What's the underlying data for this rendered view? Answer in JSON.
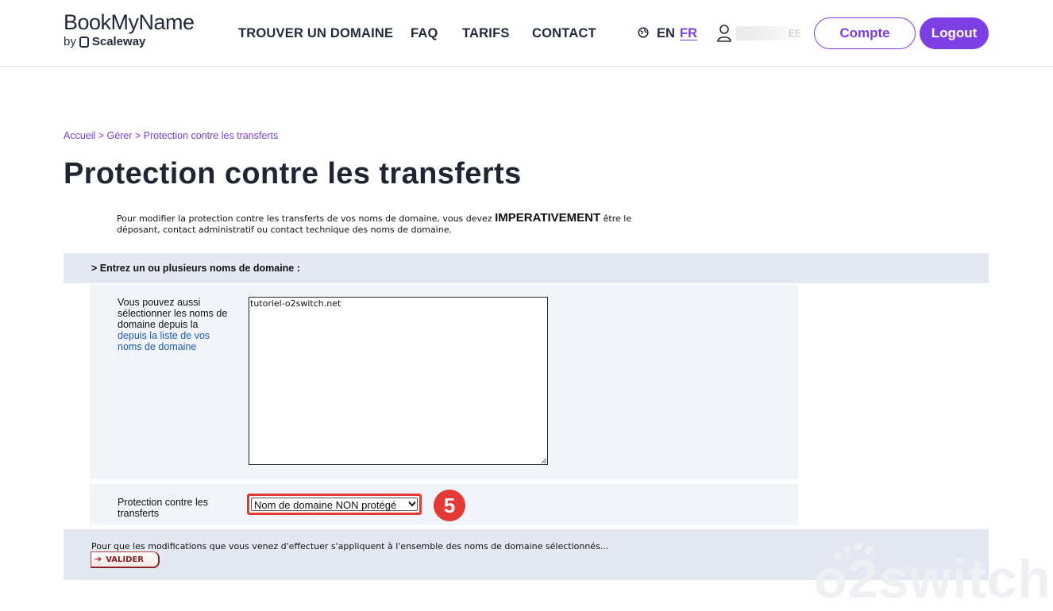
{
  "header": {
    "logo": {
      "brand": "BookMyName",
      "by": "by",
      "company": "Scaleway"
    },
    "nav": [
      "TROUVER UN DOMAINE",
      "FAQ",
      "TARIFS",
      "CONTACT"
    ],
    "lang": {
      "en": "EN",
      "fr": "FR",
      "active": "FR"
    },
    "user_name_visible": "EE",
    "account_button": "Compte",
    "logout_button": "Logout"
  },
  "breadcrumb": {
    "home": "Accueil",
    "sep": " > ",
    "manage": "Gérer",
    "current": "Protection contre les transferts"
  },
  "page_title": "Protection contre les transferts",
  "intro": {
    "before": "Pour modifier la protection contre les transferts de vos noms de domaine, vous devez ",
    "emphasis": "IMPERATIVEMENT",
    "after": " être le déposant, contact administratif ou contact technique des noms de domaine."
  },
  "section_header": "> Entrez un ou plusieurs noms de domaine :",
  "domains_panel": {
    "label_text": "Vous pouvez aussi sélectionner les noms de domaine depuis la ",
    "label_link": "depuis la liste de vos noms de domaine",
    "textarea_value": "tutoriel-o2switch.net"
  },
  "protection_panel": {
    "label": "Protection contre les transferts",
    "selected_option": "Nom de domaine NON protégé",
    "step_badge": "5"
  },
  "footer": {
    "text": "Pour que les modifications que vous venez d'effectuer s'appliquent à l'ensemble des noms de domaine sélectionnés...",
    "submit_label": "VALIDER",
    "submit_arrow": "➔"
  },
  "watermark": "o2switch",
  "colors": {
    "accent": "#7b3fe4",
    "highlight": "#e53935",
    "panel": "#f1f4f9",
    "section": "#e3e8f2"
  }
}
